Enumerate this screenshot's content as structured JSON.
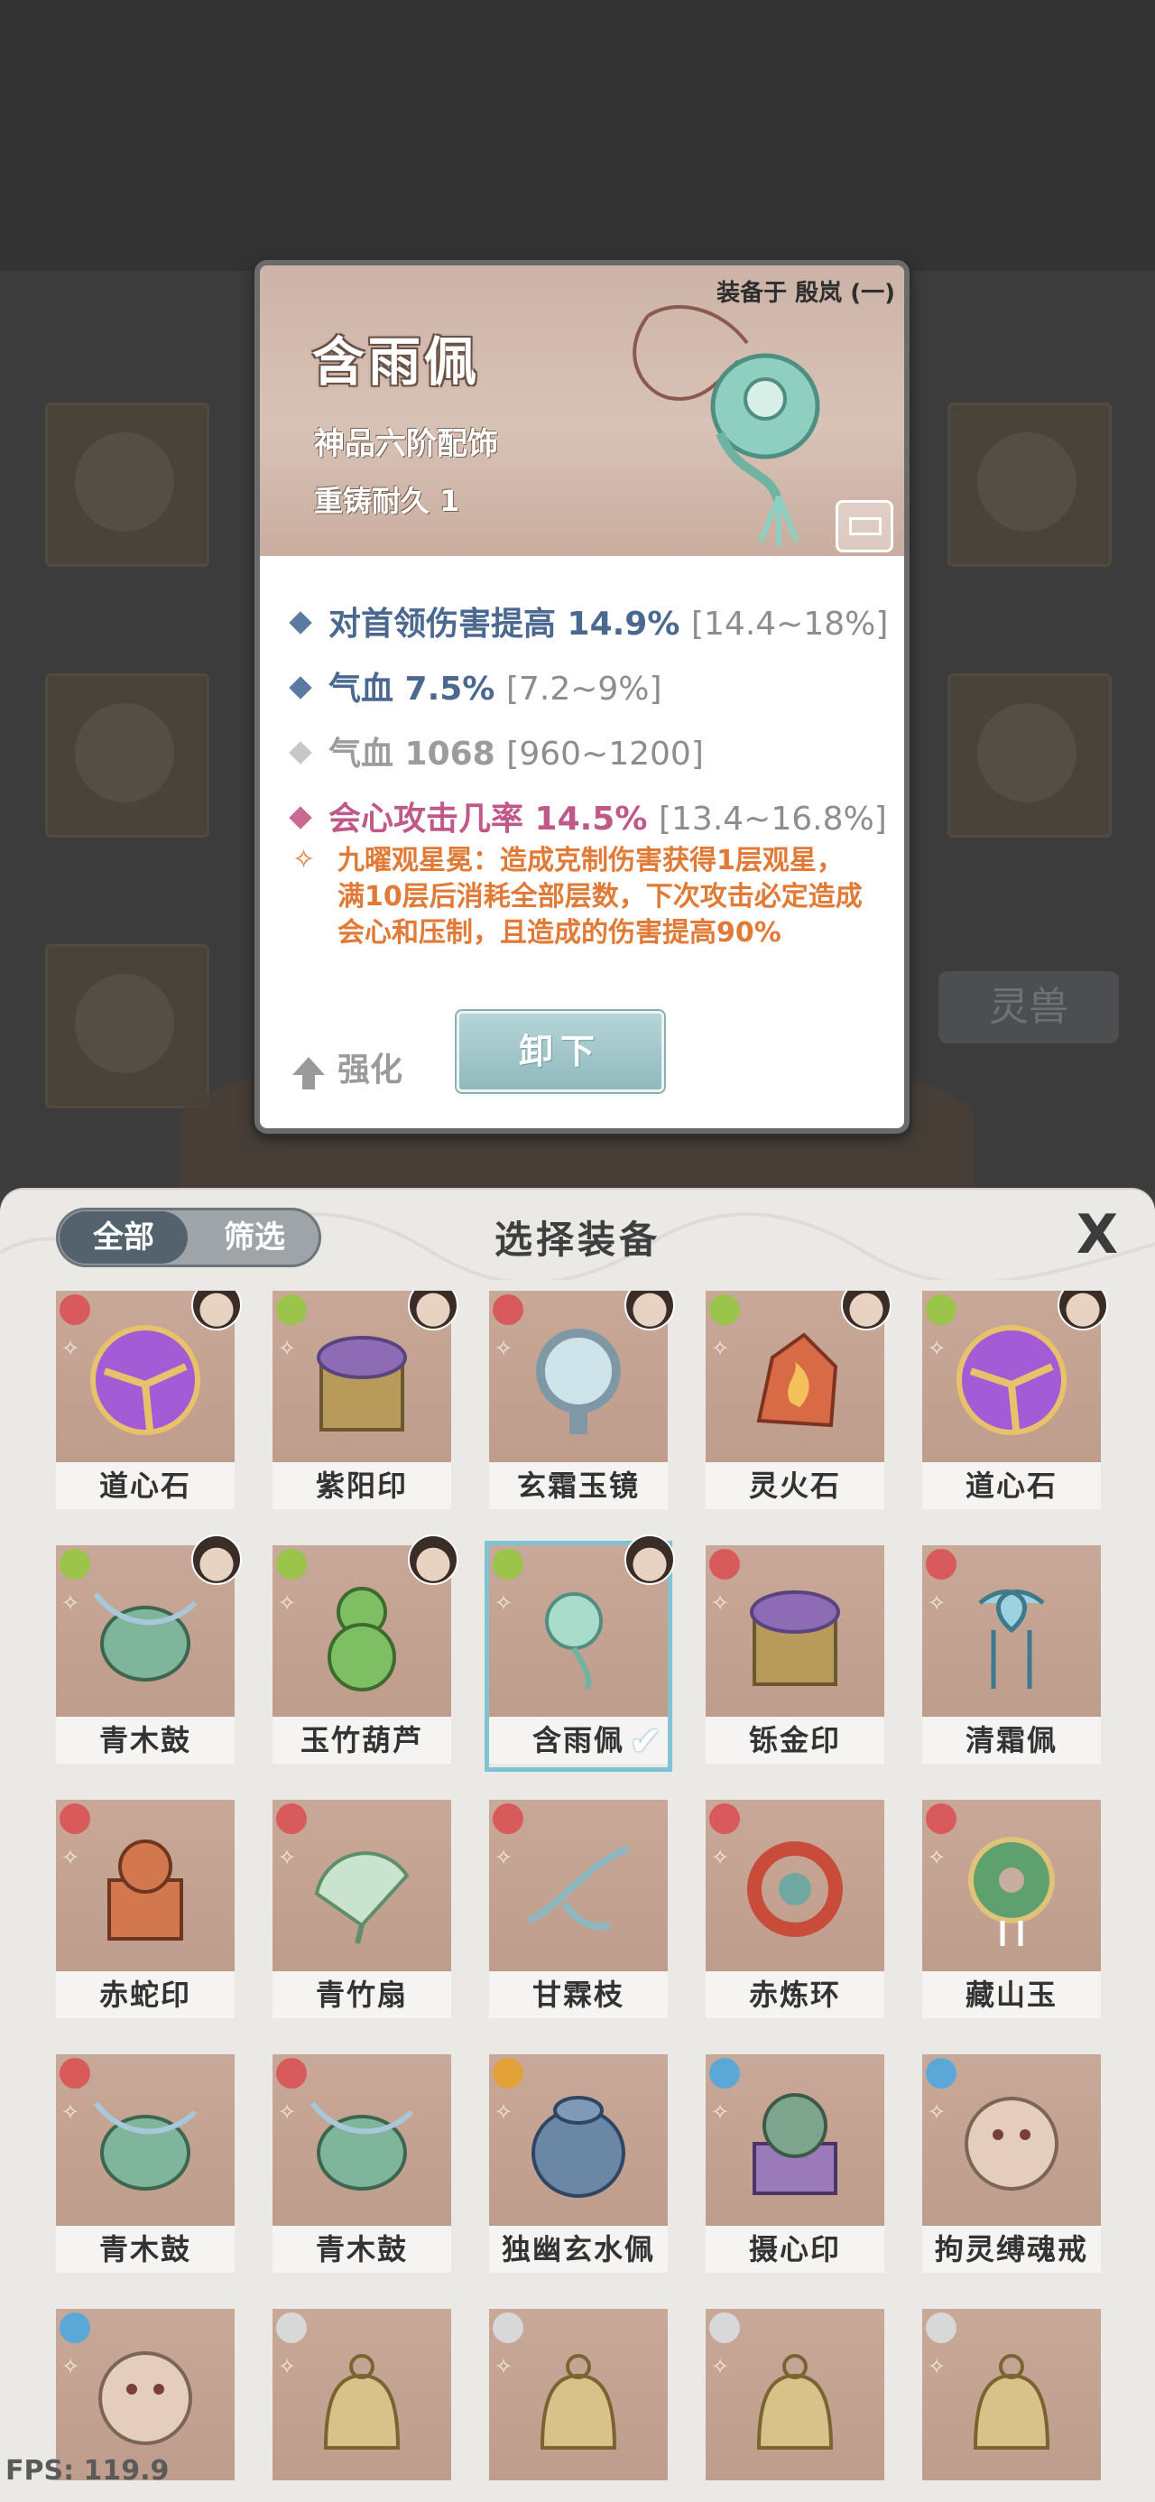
{
  "background": {
    "beast_label": "灵兽"
  },
  "tooltip": {
    "equipped_on": "装备于 殷岚 (一)",
    "name": "含雨佩",
    "grade": "神品六阶配饰",
    "durability": "重铸耐久 1",
    "stats": [
      {
        "text": "对首领伤害提高 14.9%",
        "range": "[14.4~18%]",
        "color": "#5b7aa0"
      },
      {
        "text": "气血 7.5%",
        "range": "[7.2~9%]",
        "color": "#5b7aa0"
      },
      {
        "text": "气血 1068",
        "range": "[960~1200]",
        "color": "#c7c7c7"
      },
      {
        "text": "会心攻击几率 14.5%",
        "range": "[13.4~16.8%]",
        "color": "#c86a92"
      }
    ],
    "special": "九曜观星冕：造成克制伤害获得1层观星，满10层后消耗全部层数，下次攻击必定造成会心和压制，且造成的伤害提高90%",
    "upgrade_label": "强化",
    "unequip_label": "卸下"
  },
  "panel": {
    "tab_all": "全部",
    "tab_filter": "筛选",
    "title": "选择装备",
    "close": "X"
  },
  "items": [
    {
      "label": "道心石",
      "rarity": "#d85a5a",
      "owner": true,
      "art": "purple-orb"
    },
    {
      "label": "紫阳印",
      "rarity": "#9bc44a",
      "owner": true,
      "art": "seal-gold"
    },
    {
      "label": "玄霜玉镜",
      "rarity": "#d85a5a",
      "owner": true,
      "art": "mirror"
    },
    {
      "label": "灵火石",
      "rarity": "#9bc44a",
      "owner": true,
      "art": "fire-stone"
    },
    {
      "label": "道心石",
      "rarity": "#9bc44a",
      "owner": true,
      "art": "purple-orb"
    },
    {
      "label": "青木鼓",
      "rarity": "#9bc44a",
      "owner": true,
      "art": "drum"
    },
    {
      "label": "玉竹葫芦",
      "rarity": "#9bc44a",
      "owner": true,
      "art": "gourd"
    },
    {
      "label": "含雨佩",
      "rarity": "#9bc44a",
      "owner": true,
      "art": "jade-pendant",
      "selected": true
    },
    {
      "label": "铄金印",
      "rarity": "#d85a5a",
      "owner": false,
      "art": "seal-gold"
    },
    {
      "label": "清霜佩",
      "rarity": "#d85a5a",
      "owner": false,
      "art": "ice-pendant"
    },
    {
      "label": "赤蛇印",
      "rarity": "#d85a5a",
      "owner": false,
      "art": "snake-seal"
    },
    {
      "label": "青竹扇",
      "rarity": "#d85a5a",
      "owner": false,
      "art": "fan"
    },
    {
      "label": "甘霖枝",
      "rarity": "#d85a5a",
      "owner": false,
      "art": "branch"
    },
    {
      "label": "赤炼环",
      "rarity": "#d85a5a",
      "owner": false,
      "art": "red-ring"
    },
    {
      "label": "藏山玉",
      "rarity": "#d85a5a",
      "owner": false,
      "art": "jade-disc"
    },
    {
      "label": "青木鼓",
      "rarity": "#d85a5a",
      "owner": false,
      "art": "drum"
    },
    {
      "label": "青木鼓",
      "rarity": "#d85a5a",
      "owner": false,
      "art": "drum"
    },
    {
      "label": "独幽玄水佩",
      "rarity": "#e3a13a",
      "owner": false,
      "art": "water-jar"
    },
    {
      "label": "摄心印",
      "rarity": "#5aa7d8",
      "owner": false,
      "art": "purple-seal"
    },
    {
      "label": "拘灵缚魂戒",
      "rarity": "#5aa7d8",
      "owner": false,
      "art": "beast-ring"
    },
    {
      "label": "",
      "rarity": "#5aa7d8",
      "owner": false,
      "art": "beast-ring"
    },
    {
      "label": "",
      "rarity": "#d8d8d8",
      "owner": false,
      "art": "gold-bell"
    },
    {
      "label": "",
      "rarity": "#d8d8d8",
      "owner": false,
      "art": "gold-bell"
    },
    {
      "label": "",
      "rarity": "#d8d8d8",
      "owner": false,
      "art": "gold-bell"
    },
    {
      "label": "",
      "rarity": "#d8d8d8",
      "owner": false,
      "art": "gold-bell"
    }
  ],
  "fps": "FPS: 119.9"
}
